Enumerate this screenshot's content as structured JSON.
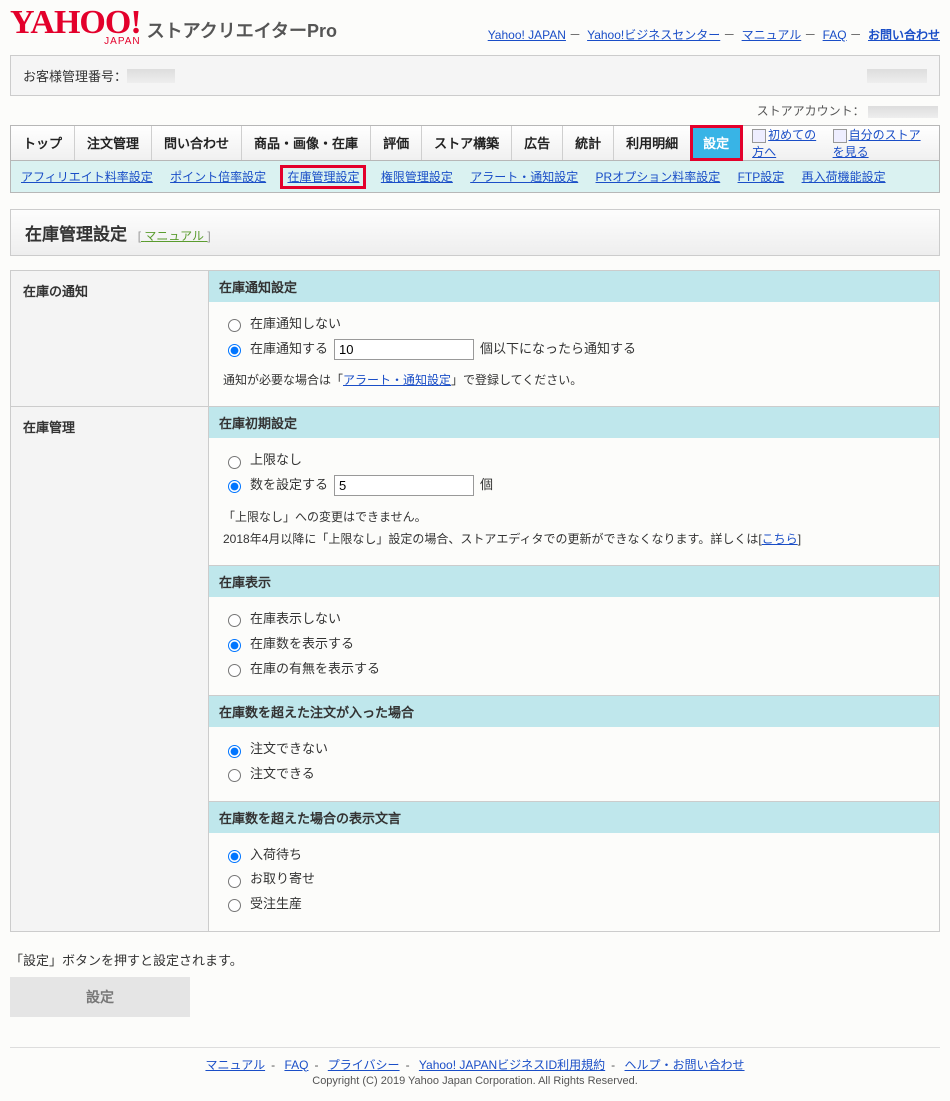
{
  "header": {
    "logo_text": "YAHOO!",
    "logo_sub": "JAPAN",
    "app_title": "ストアクリエイターPro",
    "links": {
      "yahoo_japan": "Yahoo! JAPAN",
      "biz_center": "Yahoo!ビジネスセンター",
      "manual": "マニュアル",
      "faq": "FAQ",
      "contact": "お問い合わせ"
    }
  },
  "customer_bar": {
    "label": "お客様管理番号："
  },
  "store_account_label": "ストアアカウント：",
  "tabs": {
    "items": [
      "トップ",
      "注文管理",
      "問い合わせ",
      "商品・画像・在庫",
      "評価",
      "ストア構築",
      "広告",
      "統計",
      "利用明細",
      "設定"
    ],
    "active_index": 9,
    "extras": {
      "firsttime": "初めての方へ",
      "viewstore": "自分のストアを見る"
    }
  },
  "subtabs": {
    "items": [
      "アフィリエイト料率設定",
      "ポイント倍率設定",
      "在庫管理設定",
      "権限管理設定",
      "アラート・通知設定",
      "PRオプション料率設定",
      "FTP設定",
      "再入荷機能設定"
    ],
    "current_index": 2
  },
  "page": {
    "title": "在庫管理設定",
    "manual_link": "マニュアル"
  },
  "sections": {
    "stock_notify": {
      "rowhead": "在庫の通知",
      "head": "在庫通知設定",
      "opt_none": "在庫通知しない",
      "opt_do": "在庫通知する",
      "threshold_value": "10",
      "threshold_suffix": "個以下になったら通知する",
      "note_prefix": "通知が必要な場合は「",
      "note_link": "アラート・通知設定",
      "note_suffix": "」で登録してください。"
    },
    "stock_manage": {
      "rowhead": "在庫管理",
      "initial": {
        "head": "在庫初期設定",
        "opt_nolimit": "上限なし",
        "opt_setnum": "数を設定する",
        "value": "5",
        "unit": "個",
        "note1": "「上限なし」への変更はできません。",
        "note2_prefix": "2018年4月以降に「上限なし」設定の場合、ストアエディタでの更新ができなくなります。詳しくは[",
        "note2_link": "こちら",
        "note2_suffix": "]"
      },
      "display": {
        "head": "在庫表示",
        "opt_none": "在庫表示しない",
        "opt_count": "在庫数を表示する",
        "opt_avail": "在庫の有無を表示する"
      },
      "over_order": {
        "head": "在庫数を超えた注文が入った場合",
        "opt_cannot": "注文できない",
        "opt_can": "注文できる"
      },
      "over_wording": {
        "head": "在庫数を超えた場合の表示文言",
        "opt_wait": "入荷待ち",
        "opt_order": "お取り寄せ",
        "opt_made": "受注生産"
      }
    }
  },
  "action": {
    "note": "「設定」ボタンを押すと設定されます。",
    "button": "設定"
  },
  "footer": {
    "links": {
      "manual": "マニュアル",
      "faq": "FAQ",
      "privacy": "プライバシー",
      "terms": "Yahoo! JAPANビジネスID利用規約",
      "help": "ヘルプ・お問い合わせ"
    },
    "copyright": "Copyright (C) 2019 Yahoo Japan Corporation. All Rights Reserved."
  }
}
